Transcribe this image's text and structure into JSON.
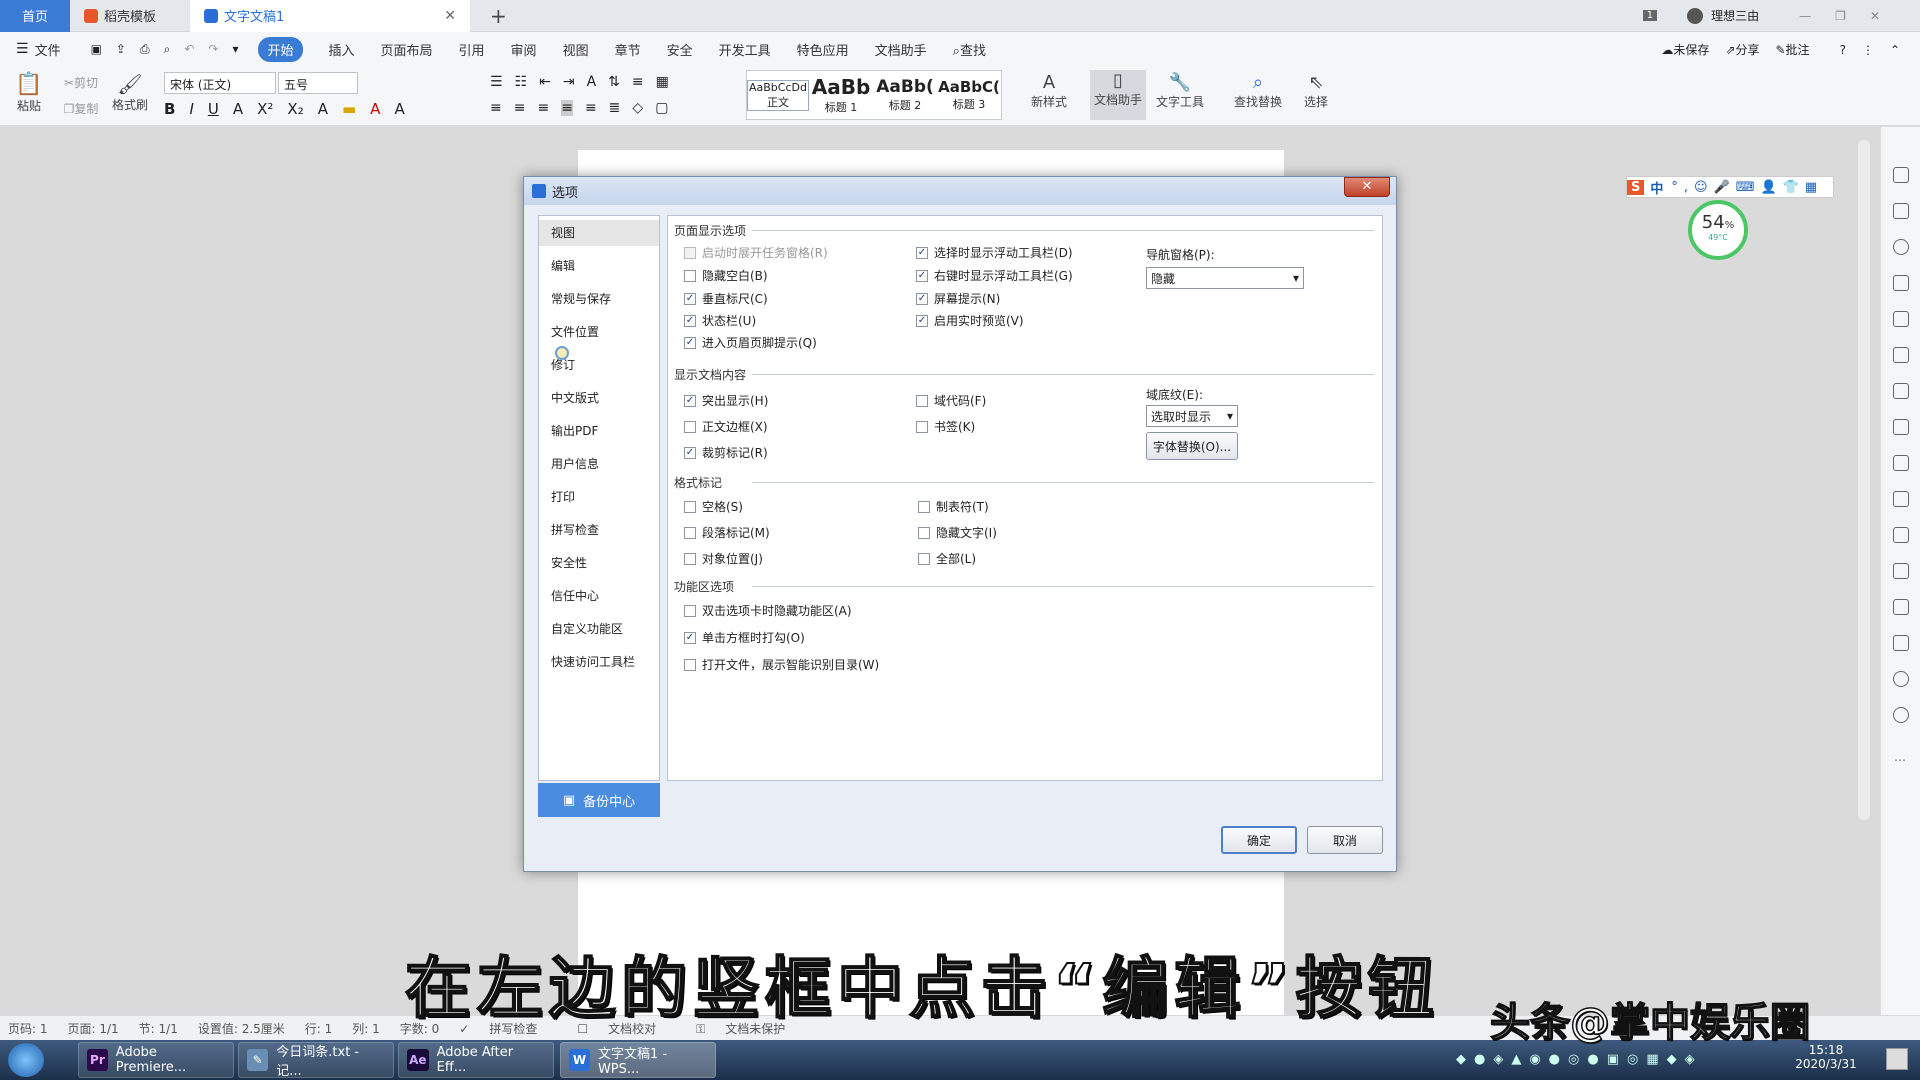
{
  "tabs": {
    "home": "首页",
    "template": "稻壳模板",
    "doc": "文字文稿1",
    "page_count": "1",
    "user": "理想三由"
  },
  "menu": {
    "file": "文件",
    "items": [
      "开始",
      "插入",
      "页面布局",
      "引用",
      "审阅",
      "视图",
      "章节",
      "安全",
      "开发工具",
      "特色应用",
      "文档助手"
    ],
    "search": "查找",
    "unsaved": "未保存",
    "share": "分享",
    "comment": "批注"
  },
  "ribbon": {
    "paste": "粘贴",
    "cut": "剪切",
    "copy": "复制",
    "format_painter": "格式刷",
    "font": "宋体 (正文)",
    "size": "五号",
    "styles": [
      {
        "preview": "AaBbCcDd",
        "name": "正文"
      },
      {
        "preview": "AaBb",
        "name": "标题 1"
      },
      {
        "preview": "AaBb(",
        "name": "标题 2"
      },
      {
        "preview": "AaBbC(",
        "name": "标题 3"
      }
    ],
    "new_style": "新样式",
    "doc_assistant": "文档助手",
    "text_tools": "文字工具",
    "find_replace": "查找替换",
    "select": "选择"
  },
  "dialog": {
    "title": "选项",
    "nav": [
      "视图",
      "编辑",
      "常规与保存",
      "文件位置",
      "修订",
      "中文版式",
      "输出PDF",
      "用户信息",
      "打印",
      "拼写检查",
      "安全性",
      "信任中心",
      "自定义功能区",
      "快速访问工具栏"
    ],
    "backup": "备份中心",
    "sections": {
      "page_display": "页面显示选项",
      "doc_content": "显示文档内容",
      "format_marks": "格式标记",
      "ribbon_opts": "功能区选项"
    },
    "opts": {
      "o1": "启动时展开任务窗格(R)",
      "o2": "隐藏空白(B)",
      "o3": "垂直标尺(C)",
      "o4": "状态栏(U)",
      "o5": "进入页眉页脚提示(Q)",
      "o6": "选择时显示浮动工具栏(D)",
      "o7": "右键时显示浮动工具栏(G)",
      "o8": "屏幕提示(N)",
      "o9": "启用实时预览(V)",
      "o10": "突出显示(H)",
      "o11": "正文边框(X)",
      "o12": "裁剪标记(R)",
      "o13": "域代码(F)",
      "o14": "书签(K)",
      "o15": "空格(S)",
      "o16": "段落标记(M)",
      "o17": "对象位置(J)",
      "o18": "制表符(T)",
      "o19": "隐藏文字(I)",
      "o20": "全部(L)",
      "o21": "双击选项卡时隐藏功能区(A)",
      "o22": "单击方框时打勾(O)",
      "o23": "打开文件，展示智能识别目录(W)"
    },
    "check": "✓",
    "nav_pane_label": "导航窗格(P):",
    "nav_pane_value": "隐藏",
    "field_shading_label": "域底纹(E):",
    "field_shading_value": "选取时显示",
    "font_sub": "字体替换(O)...",
    "ok": "确定",
    "cancel": "取消"
  },
  "widget": {
    "ime": "中",
    "cpu": "54",
    "cpu_unit": "%",
    "temp": "49°C"
  },
  "status": {
    "page": "页码: 1",
    "pages": "页面: 1/1",
    "section": "节: 1/1",
    "setting": "设置值: 2.5厘米",
    "row": "行: 1",
    "col": "列: 1",
    "words": "字数: 0",
    "spell": "拼写检查",
    "proof": "文档校对",
    "protect": "文档未保护"
  },
  "taskbar": [
    {
      "icon": "Pr",
      "label": "Adobe Premiere...",
      "color": "#2a0a4a"
    },
    {
      "icon": "✎",
      "label": "今日词条.txt - 记...",
      "color": "#6a8fb5"
    },
    {
      "icon": "Ae",
      "label": "Adobe After Eff...",
      "color": "#1a0a3a"
    },
    {
      "icon": "W",
      "label": "文字文稿1 - WPS...",
      "color": "#2b6fd6"
    }
  ],
  "clock": {
    "time": "15:18",
    "date": "2020/3/31"
  },
  "subtitle": "在左边的竖框中点击“编辑”按钮",
  "watermark": "头条@掌中娱乐圈"
}
